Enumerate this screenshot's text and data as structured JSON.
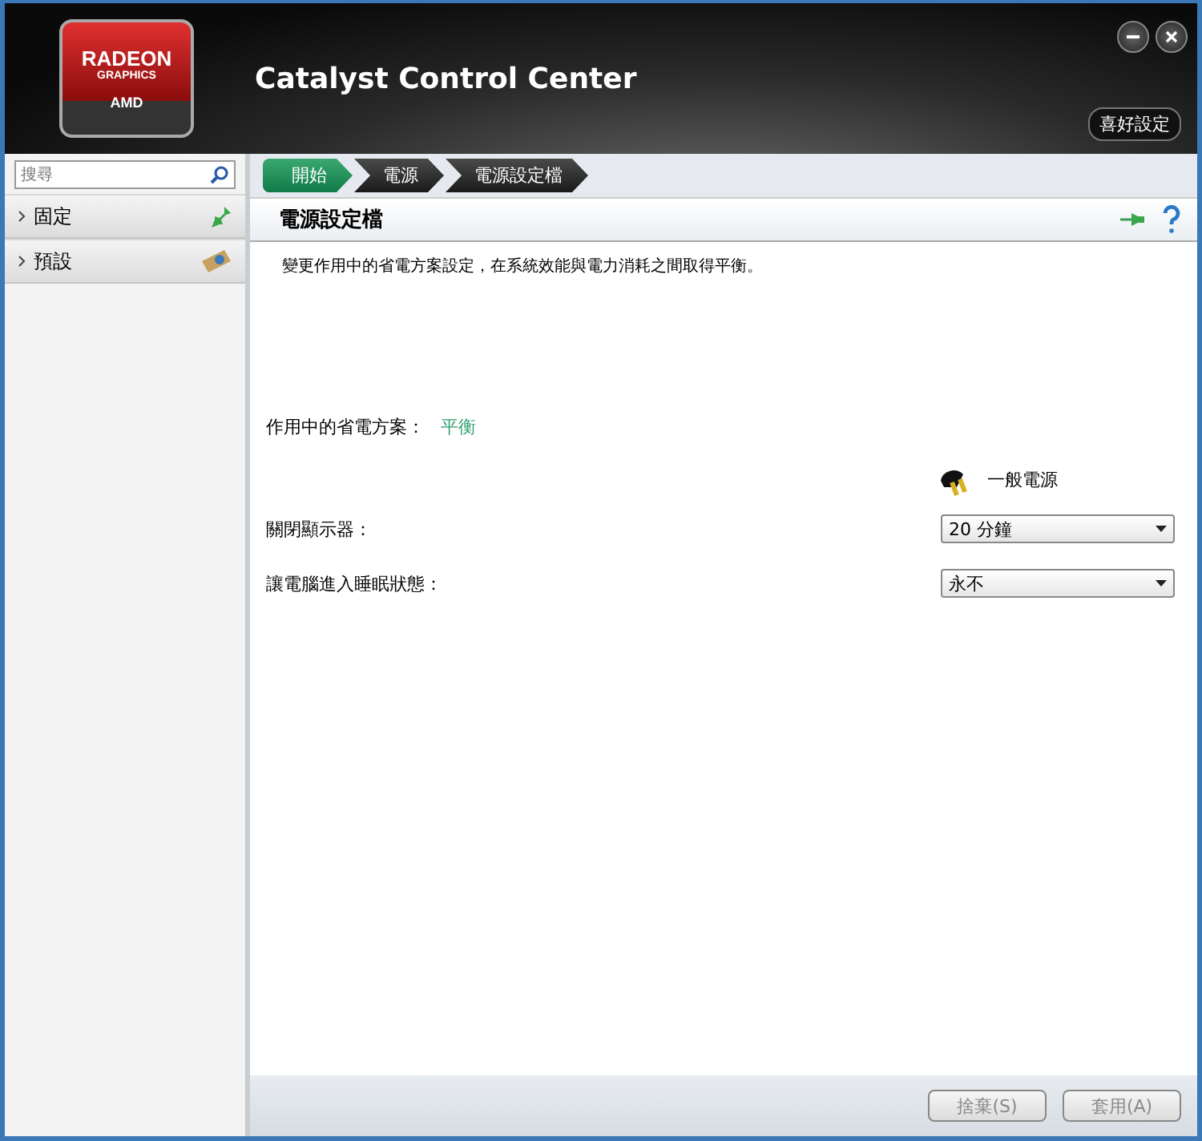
{
  "header": {
    "logo": {
      "line1": "RADEON",
      "line2": "GRAPHICS",
      "brand": "AMD"
    },
    "title": "Catalyst Control Center",
    "preferences": "喜好設定"
  },
  "sidebar": {
    "search": {
      "placeholder": "搜尋"
    },
    "items": [
      {
        "label": "固定",
        "kind": "pin",
        "expanded": false
      },
      {
        "label": "預設",
        "kind": "preset",
        "expanded": false
      }
    ]
  },
  "breadcrumb": [
    {
      "label": "開始",
      "selected": true
    },
    {
      "label": "電源",
      "selected": false
    },
    {
      "label": "電源設定檔",
      "selected": false
    }
  ],
  "page": {
    "title": "電源設定檔",
    "description": "變更作用中的省電方案設定，在系統效能與電力消耗之間取得平衡。",
    "active_plan": {
      "label": "作用中的省電方案：",
      "value": "平衡"
    },
    "power_source": "一般電源",
    "settings": [
      {
        "label": "關閉顯示器：",
        "value": "20 分鐘"
      },
      {
        "label": "讓電腦進入睡眠狀態：",
        "value": "永不"
      }
    ]
  },
  "buttons": [
    {
      "label": "捨棄(S)",
      "disabled": true
    },
    {
      "label": "套用(A)",
      "disabled": true
    }
  ]
}
